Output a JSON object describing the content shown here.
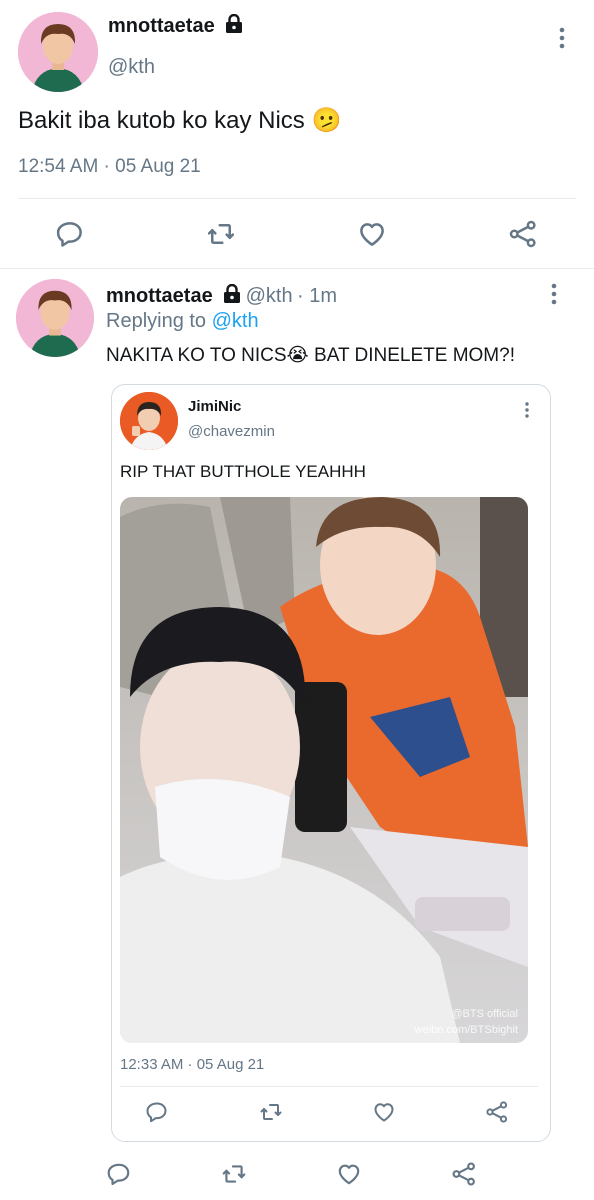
{
  "main_tweet": {
    "display_name": "mnottaetae",
    "handle": "@kth",
    "text": "Bakit iba kutob ko kay Nics",
    "emoji": "🫤",
    "timestamp": "12:54 AM · 05 Aug 21"
  },
  "reply_tweet": {
    "display_name": "mnottaetae",
    "handle": "@kth",
    "age": "· 1m",
    "replying_label": "Replying to",
    "replying_to": "@kth",
    "text": "NAKITA KO TO NICS😭 BAT DINELETE MOM?!"
  },
  "quoted_tweet": {
    "display_name": "JimiNic",
    "handle": "@chavezmin",
    "text": "RIP THAT BUTTHOLE YEAHHH",
    "timestamp": "12:33 AM · 05 Aug 21",
    "watermark_line1": "@BTS official",
    "watermark_line2": "weibo.com/BTSbighit"
  },
  "icons": {
    "reply": "reply-icon",
    "retweet": "retweet-icon",
    "like": "heart-icon",
    "share": "share-icon",
    "more": "more-vertical-icon",
    "lock": "lock-icon"
  },
  "colors": {
    "text": "#14171a",
    "muted": "#657786",
    "link": "#1da1f2",
    "divider": "#e6ecf0"
  }
}
